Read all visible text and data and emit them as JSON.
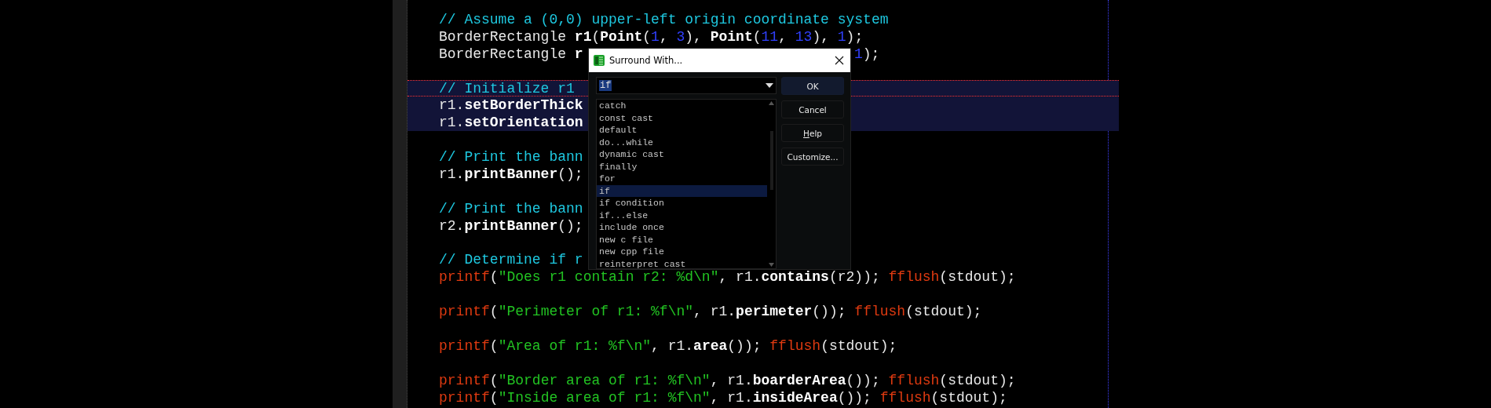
{
  "editor": {
    "lines": [
      {
        "selected": false,
        "tokens": [
          {
            "kind": "comment",
            "text": "// Assume a (0,0) upper-left origin coordinate system"
          }
        ]
      },
      {
        "selected": false,
        "tokens": [
          {
            "kind": "plain",
            "text": "BorderRectangle "
          },
          {
            "kind": "bold",
            "text": "r1"
          },
          {
            "kind": "plain",
            "text": "("
          },
          {
            "kind": "bold",
            "text": "Point"
          },
          {
            "kind": "plain",
            "text": "("
          },
          {
            "kind": "num",
            "text": "1"
          },
          {
            "kind": "plain",
            "text": ", "
          },
          {
            "kind": "num",
            "text": "3"
          },
          {
            "kind": "plain",
            "text": "), "
          },
          {
            "kind": "bold",
            "text": "Point"
          },
          {
            "kind": "plain",
            "text": "("
          },
          {
            "kind": "num",
            "text": "11"
          },
          {
            "kind": "plain",
            "text": ", "
          },
          {
            "kind": "num",
            "text": "13"
          },
          {
            "kind": "plain",
            "text": "), "
          },
          {
            "kind": "num",
            "text": "1"
          },
          {
            "kind": "plain",
            "text": ");"
          }
        ]
      },
      {
        "selected": false,
        "cut": true,
        "tokens": [
          {
            "kind": "plain",
            "text": "BorderRectangle "
          },
          {
            "kind": "bold",
            "text": "r"
          }
        ],
        "after": [
          {
            "kind": "num",
            "text": "1"
          },
          {
            "kind": "plain",
            "text": ");"
          }
        ]
      },
      {
        "selected": false
      },
      {
        "selected": true,
        "current": true,
        "cut": true,
        "tokens": [
          {
            "kind": "comment",
            "text": "// Initialize r1"
          }
        ]
      },
      {
        "selected": true,
        "cut": true,
        "tokens": [
          {
            "kind": "plain",
            "text": "r1."
          },
          {
            "kind": "bold",
            "text": "setBorderThick"
          }
        ]
      },
      {
        "selected": true,
        "cut": true,
        "tokens": [
          {
            "kind": "plain",
            "text": "r1."
          },
          {
            "kind": "bold",
            "text": "setOrientation"
          }
        ]
      },
      {
        "selected": false
      },
      {
        "selected": false,
        "cut": true,
        "tokens": [
          {
            "kind": "comment",
            "text": "// Print the bann"
          }
        ]
      },
      {
        "selected": false,
        "tokens": [
          {
            "kind": "plain",
            "text": "r1."
          },
          {
            "kind": "bold",
            "text": "printBanner"
          },
          {
            "kind": "plain",
            "text": "();"
          }
        ]
      },
      {
        "selected": false
      },
      {
        "selected": false,
        "cut": true,
        "tokens": [
          {
            "kind": "comment",
            "text": "// Print the bann"
          }
        ]
      },
      {
        "selected": false,
        "tokens": [
          {
            "kind": "plain",
            "text": "r2."
          },
          {
            "kind": "bold",
            "text": "printBanner"
          },
          {
            "kind": "plain",
            "text": "();"
          }
        ]
      },
      {
        "selected": false
      },
      {
        "selected": false,
        "cut": true,
        "tokens": [
          {
            "kind": "comment",
            "text": "// Determine if r"
          }
        ]
      },
      {
        "selected": false,
        "tokens": [
          {
            "kind": "func",
            "text": "printf"
          },
          {
            "kind": "plain",
            "text": "("
          },
          {
            "kind": "str",
            "text": "\"Does r1 contain r2: %d\\n\""
          },
          {
            "kind": "plain",
            "text": ", r1."
          },
          {
            "kind": "bold",
            "text": "contains"
          },
          {
            "kind": "plain",
            "text": "(r2)); "
          },
          {
            "kind": "func",
            "text": "fflush"
          },
          {
            "kind": "plain",
            "text": "(stdout);"
          }
        ]
      },
      {
        "selected": false
      },
      {
        "selected": false,
        "tokens": [
          {
            "kind": "func",
            "text": "printf"
          },
          {
            "kind": "plain",
            "text": "("
          },
          {
            "kind": "str",
            "text": "\"Perimeter of r1: %f\\n\""
          },
          {
            "kind": "plain",
            "text": ", r1."
          },
          {
            "kind": "bold",
            "text": "perimeter"
          },
          {
            "kind": "plain",
            "text": "()); "
          },
          {
            "kind": "func",
            "text": "fflush"
          },
          {
            "kind": "plain",
            "text": "(stdout);"
          }
        ]
      },
      {
        "selected": false
      },
      {
        "selected": false,
        "tokens": [
          {
            "kind": "func",
            "text": "printf"
          },
          {
            "kind": "plain",
            "text": "("
          },
          {
            "kind": "str",
            "text": "\"Area of r1: %f\\n\""
          },
          {
            "kind": "plain",
            "text": ", r1."
          },
          {
            "kind": "bold",
            "text": "area"
          },
          {
            "kind": "plain",
            "text": "()); "
          },
          {
            "kind": "func",
            "text": "fflush"
          },
          {
            "kind": "plain",
            "text": "(stdout);"
          }
        ]
      },
      {
        "selected": false
      },
      {
        "selected": false,
        "tokens": [
          {
            "kind": "func",
            "text": "printf"
          },
          {
            "kind": "plain",
            "text": "("
          },
          {
            "kind": "str",
            "text": "\"Border area of r1: %f\\n\""
          },
          {
            "kind": "plain",
            "text": ", r1."
          },
          {
            "kind": "bold",
            "text": "boarderArea"
          },
          {
            "kind": "plain",
            "text": "()); "
          },
          {
            "kind": "func",
            "text": "fflush"
          },
          {
            "kind": "plain",
            "text": "(stdout);"
          }
        ]
      },
      {
        "selected": false,
        "tokens": [
          {
            "kind": "func",
            "text": "printf"
          },
          {
            "kind": "plain",
            "text": "("
          },
          {
            "kind": "str",
            "text": "\"Inside area of r1: %f\\n\""
          },
          {
            "kind": "plain",
            "text": ", r1."
          },
          {
            "kind": "bold",
            "text": "insideArea"
          },
          {
            "kind": "plain",
            "text": "()); "
          },
          {
            "kind": "func",
            "text": "fflush"
          },
          {
            "kind": "plain",
            "text": "(stdout);"
          }
        ]
      }
    ]
  },
  "dialog": {
    "title": "Surround With...",
    "combo": {
      "value": "if"
    },
    "items": [
      {
        "label": "catch",
        "selected": false
      },
      {
        "label": "const cast",
        "selected": false
      },
      {
        "label": "default",
        "selected": false
      },
      {
        "label": "do...while",
        "selected": false
      },
      {
        "label": "dynamic cast",
        "selected": false
      },
      {
        "label": "finally",
        "selected": false
      },
      {
        "label": "for",
        "selected": false
      },
      {
        "label": "if",
        "selected": true
      },
      {
        "label": "if condition",
        "selected": false
      },
      {
        "label": "if...else",
        "selected": false
      },
      {
        "label": "include once",
        "selected": false
      },
      {
        "label": "new c file",
        "selected": false
      },
      {
        "label": "new cpp file",
        "selected": false
      },
      {
        "label": "reinterpret cast",
        "selected": false
      }
    ],
    "buttons": [
      {
        "label": "OK",
        "default": true
      },
      {
        "label": "Cancel",
        "default": false
      },
      {
        "label": "Help",
        "default": false
      },
      {
        "label": "Customize...",
        "default": false
      }
    ]
  }
}
